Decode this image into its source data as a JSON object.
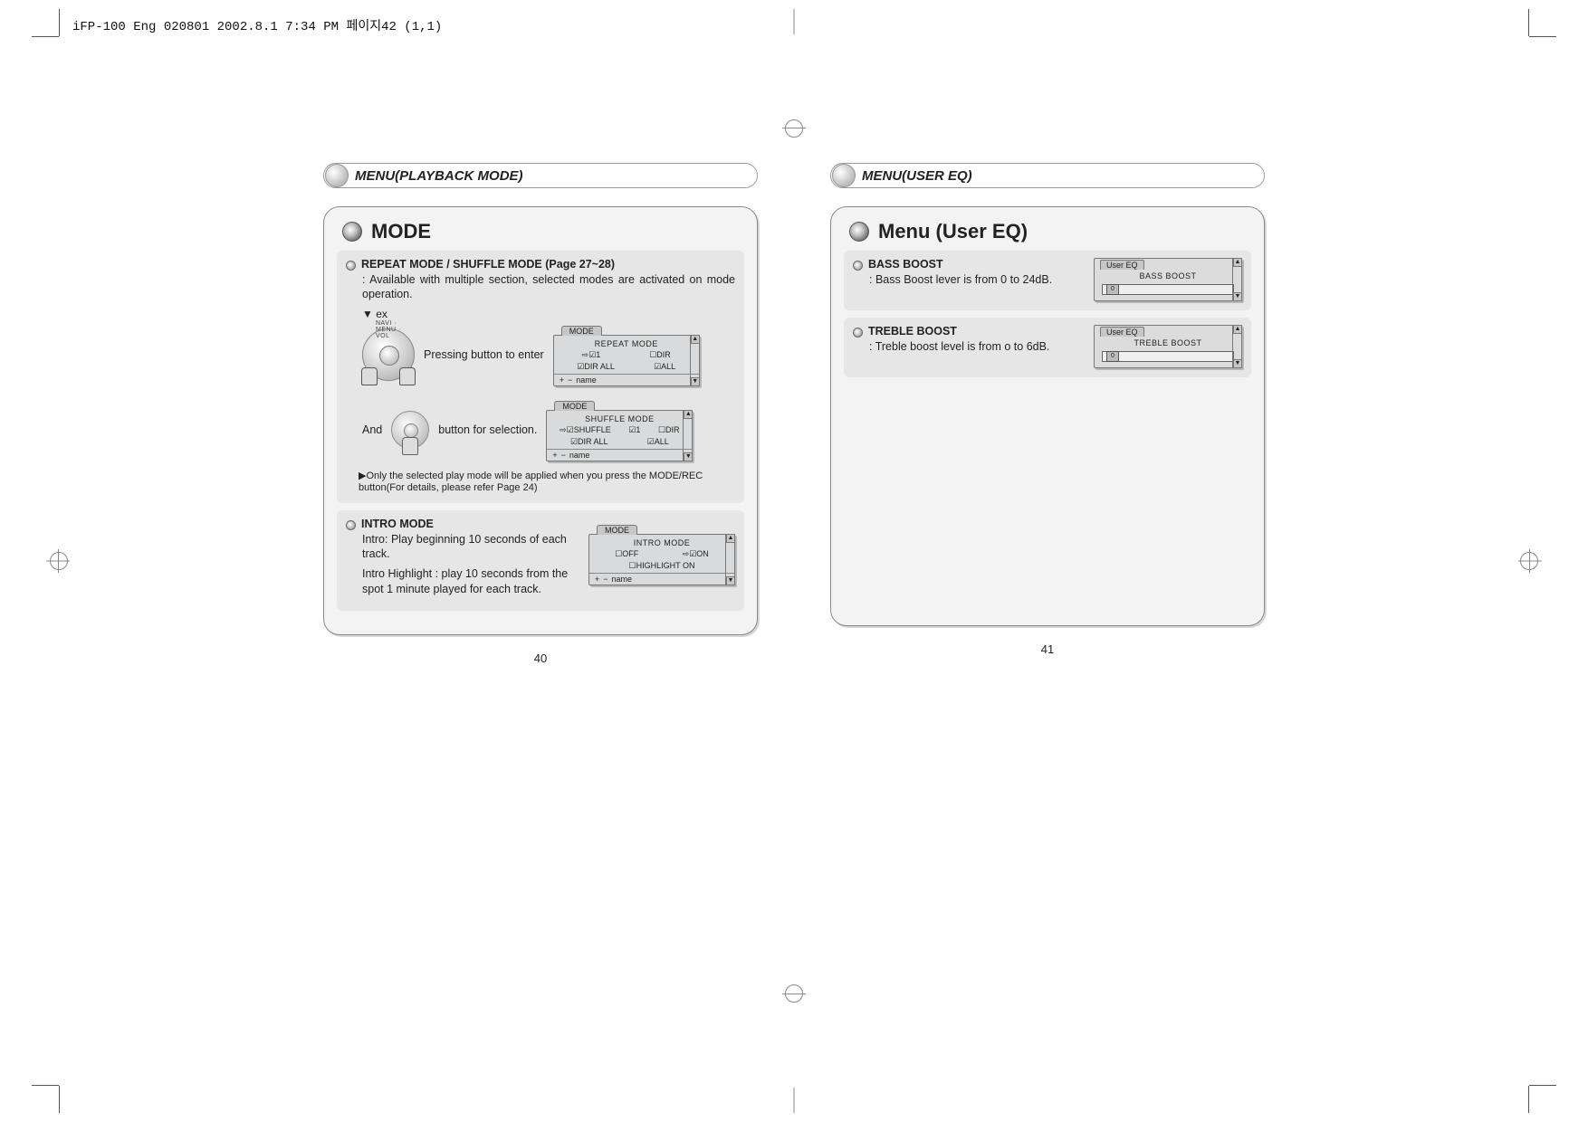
{
  "doc_header": "iFP-100 Eng 020801 2002.8.1 7:34 PM 페이지42 (1,1)",
  "left": {
    "section_header": "MENU(PLAYBACK MODE)",
    "panel_title": "MODE",
    "repeat_shuffle_title": "REPEAT MODE / SHUFFLE MODE (Page 27~28)",
    "repeat_shuffle_desc": ": Available with multiple section, selected modes are activated on mode operation.",
    "ex_label": "▼ ex",
    "dial_caption": "NAVI · MENU · VOL",
    "enter_text": "Pressing button to enter",
    "and_text": "And",
    "select_text": "button for selection.",
    "mode_note": "▶Only the selected play mode will be applied when you press the MODE/REC button(For details, please refer Page 24)",
    "lcd1": {
      "tab": "MODE",
      "title": "REPEAT MODE",
      "opts_a": [
        "⇨☑1",
        "☐DIR"
      ],
      "opts_b": [
        "☑DIR ALL",
        "☑ALL"
      ],
      "foot_plus": "+",
      "foot_minus": "−",
      "foot_name": "name"
    },
    "lcd2": {
      "tab": "MODE",
      "title": "SHUFFLE MODE",
      "opts_a": [
        "⇨☑SHUFFLE",
        "☑1",
        "☐DIR"
      ],
      "opts_b": [
        "☑DIR ALL",
        "☑ALL"
      ],
      "foot_plus": "+",
      "foot_minus": "−",
      "foot_name": "name"
    },
    "intro_title": "INTRO MODE",
    "intro_desc1": "Intro: Play beginning 10 seconds of each track.",
    "intro_desc2": "Intro Highlight : play 10 seconds from the spot 1 minute played for each track.",
    "lcd3": {
      "tab": "MODE",
      "title": "INTRO MODE",
      "opts_a": [
        "☐OFF",
        "⇨☑ON"
      ],
      "opts_b": [
        "☐HIGHLIGHT ON"
      ],
      "foot_plus": "+",
      "foot_minus": "−",
      "foot_name": "name"
    },
    "page_num": "40"
  },
  "right": {
    "section_header": "MENU(USER EQ)",
    "panel_title": "Menu (User EQ)",
    "bass_title": "BASS BOOST",
    "bass_desc": ": Bass Boost lever is from 0 to 24dB.",
    "bass_lcd": {
      "tab": "User EQ",
      "title": "BASS BOOST",
      "value": "0"
    },
    "treble_title": "TREBLE BOOST",
    "treble_desc": ": Treble boost level is from o to 6dB.",
    "treble_lcd": {
      "tab": "User EQ",
      "title": "TREBLE BOOST",
      "value": "0"
    },
    "page_num": "41"
  }
}
